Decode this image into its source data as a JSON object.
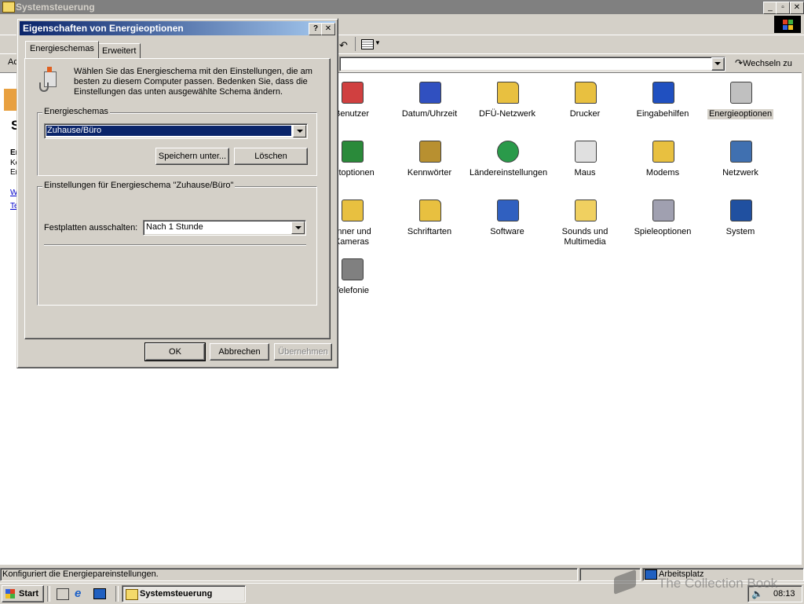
{
  "main_window": {
    "title": "Systemsteuerung",
    "address_label": "Ac",
    "go_label": "Wechseln zu"
  },
  "left_panel": {
    "heading": "S",
    "bold_line": "Er",
    "lines": [
      "Ko",
      "Er"
    ],
    "links": [
      "We",
      "Te"
    ]
  },
  "control_panel_items": [
    {
      "label": "Benutzer",
      "icon": "users-icon"
    },
    {
      "label": "Datum/Uhrzeit",
      "icon": "date-time-icon"
    },
    {
      "label": "DFÜ-Netzwerk",
      "icon": "dialup-network-icon"
    },
    {
      "label": "Drucker",
      "icon": "printer-folder-icon"
    },
    {
      "label": "Eingabehilfen",
      "icon": "accessibility-icon"
    },
    {
      "label": "Energieoptionen",
      "icon": "power-options-icon",
      "selected": true
    },
    {
      "label": "netoptionen",
      "icon": "internet-options-icon"
    },
    {
      "label": "Kennwörter",
      "icon": "keys-icon"
    },
    {
      "label": "Ländereinstellungen",
      "icon": "globe-icon"
    },
    {
      "label": "Maus",
      "icon": "mouse-icon"
    },
    {
      "label": "Modems",
      "icon": "modem-phone-icon"
    },
    {
      "label": "Netzwerk",
      "icon": "network-icon"
    },
    {
      "label": "anner und\nKameras",
      "icon": "scanner-camera-icon"
    },
    {
      "label": "Schriftarten",
      "icon": "fonts-folder-icon"
    },
    {
      "label": "Software",
      "icon": "software-icon"
    },
    {
      "label": "Sounds und\nMultimedia",
      "icon": "speaker-icon"
    },
    {
      "label": "Spieleoptionen",
      "icon": "joystick-icon"
    },
    {
      "label": "System",
      "icon": "computer-icon"
    },
    {
      "label": "Telefonie",
      "icon": "telephony-icon"
    }
  ],
  "dialog": {
    "title": "Eigenschaften von Energieoptionen",
    "tabs": [
      "Energieschemas",
      "Erweitert"
    ],
    "description": "Wählen Sie das Energieschema mit den Einstellungen, die am besten zu diesem Computer passen. Bedenken Sie, dass die Einstellungen das unten ausgewählte Schema ändern.",
    "schemes_group": "Energieschemas",
    "scheme_value": "Zuhause/Büro",
    "save_as": "Speichern unter...",
    "delete": "Löschen",
    "settings_group": "Einstellungen für Energieschema \"Zuhause/Büro\"",
    "harddisk_label": "Festplatten ausschalten:",
    "harddisk_value": "Nach 1 Stunde",
    "ok": "OK",
    "cancel": "Abbrechen",
    "apply": "Übernehmen"
  },
  "status_bar": {
    "text": "Konfiguriert die Energiepareinstellungen.",
    "zone": "Arbeitsplatz"
  },
  "taskbar": {
    "start": "Start",
    "task": "Systemsteuerung",
    "clock": "08:13"
  },
  "watermark": "The Collection Book"
}
